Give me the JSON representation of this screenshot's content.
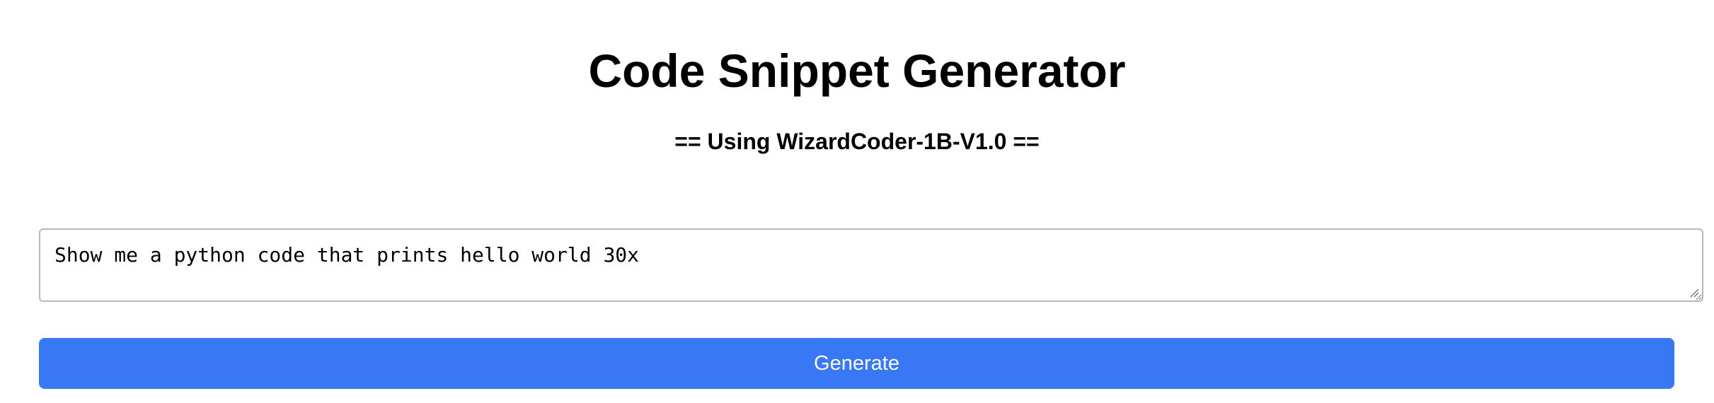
{
  "header": {
    "title": "Code Snippet Generator",
    "subtitle": "== Using WizardCoder-1B-V1.0 =="
  },
  "prompt": {
    "value": "Show me a python code that prints hello world 30x",
    "placeholder": ""
  },
  "actions": {
    "generate_label": "Generate"
  },
  "colors": {
    "button_bg": "#3878f5",
    "button_text": "#ffffff",
    "input_border": "#b8b8b8"
  },
  "icons": {
    "resize": "resize-grip-icon"
  }
}
